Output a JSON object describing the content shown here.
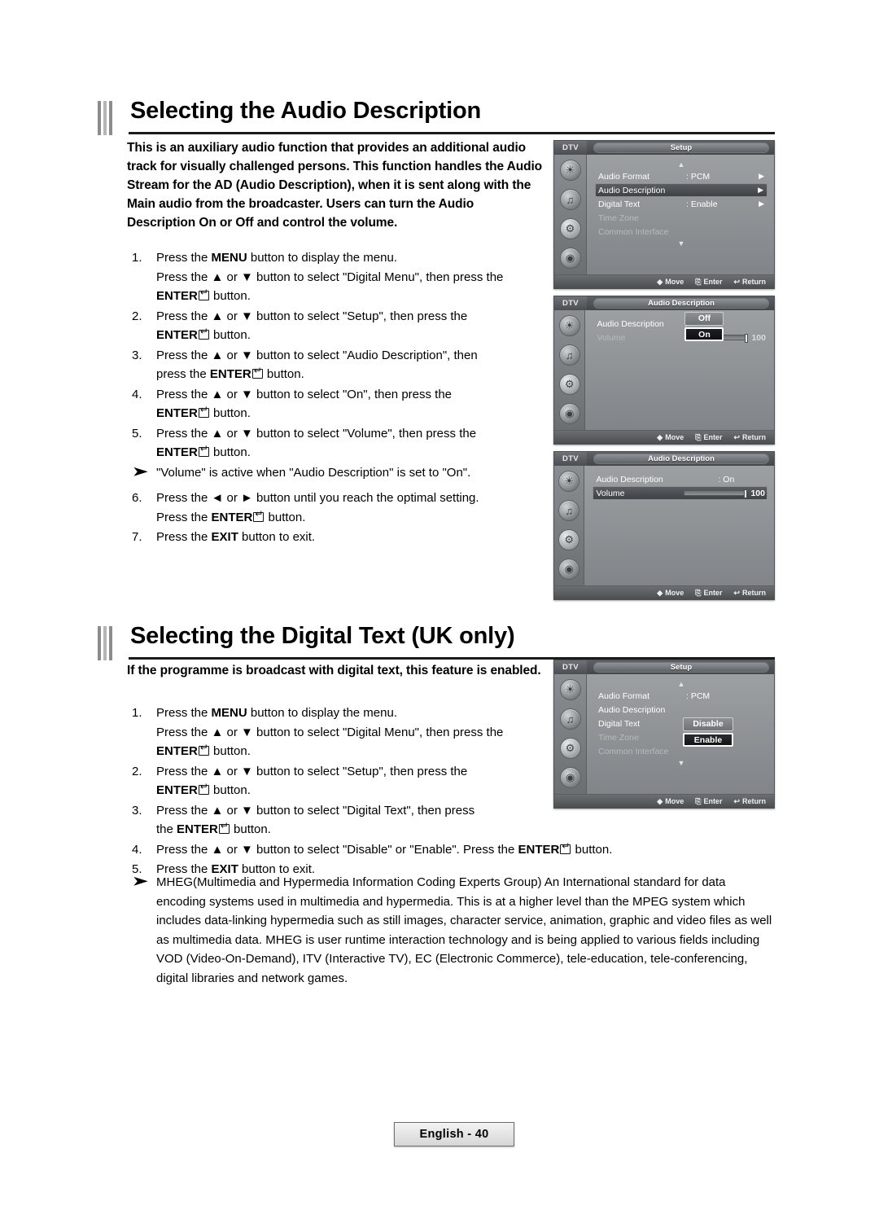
{
  "sections": [
    {
      "title": "Selecting the Audio Description",
      "intro": "This is an auxiliary audio function that provides an additional audio track for visually challenged persons. This function handles the Audio Stream for the AD (Audio Description), when it is sent along with the Main audio from the broadcaster. Users can turn the Audio Description On or Off and control the volume."
    },
    {
      "title": "Selecting the Digital Text (UK only)",
      "intro": "If the programme is broadcast with digital text, this feature is enabled."
    }
  ],
  "steps_audio": [
    {
      "num": "1.",
      "lines": [
        "Press the MENU button to display the menu.",
        "Press the ▲ or ▼ button to select \"Digital Menu\", then press the",
        "ENTER⏎ button."
      ]
    },
    {
      "num": "2.",
      "lines": [
        "Press the ▲ or ▼ button to select \"Setup\", then press the",
        "ENTER⏎ button."
      ]
    },
    {
      "num": "3.",
      "lines": [
        "Press the ▲ or ▼ button to select \"Audio Description\", then",
        "press the ENTER⏎ button."
      ]
    },
    {
      "num": "4.",
      "lines": [
        "Press the ▲ or ▼ button to select \"On\", then press the",
        "ENTER⏎ button."
      ]
    },
    {
      "num": "5.",
      "lines": [
        "Press the ▲ or ▼ button to select \"Volume\", then press the",
        "ENTER⏎ button."
      ]
    },
    {
      "num": "6.",
      "lines": [
        "Press the ◄ or ► button until you reach the optimal setting.",
        "Press the ENTER⏎ button."
      ]
    },
    {
      "num": "7.",
      "lines": [
        "Press the EXIT button to exit."
      ]
    }
  ],
  "note_audio": "\"Volume\" is active when \"Audio Description\" is set to \"On\".",
  "steps_text": [
    {
      "num": "1.",
      "lines": [
        "Press the MENU button to display the menu.",
        "Press the ▲ or ▼ button to select \"Digital Menu\", then press the",
        "ENTER⏎ button."
      ]
    },
    {
      "num": "2.",
      "lines": [
        "Press the ▲ or ▼ button to select \"Setup\", then press the",
        "ENTER⏎ button."
      ]
    },
    {
      "num": "3.",
      "lines": [
        "Press the ▲ or ▼ button to select \"Digital Text\", then press",
        "the ENTER⏎ button."
      ]
    },
    {
      "num": "4.",
      "lines": [
        "Press the ▲ or ▼ button to select \"Disable\" or \"Enable\". Press the ENTER⏎ button."
      ]
    },
    {
      "num": "5.",
      "lines": [
        "Press the EXIT button to exit."
      ]
    }
  ],
  "mheg_note": "MHEG(Multimedia and Hypermedia Information Coding Experts Group) An International standard for data encoding systems used in multimedia and hypermedia. This is at a higher level than the MPEG system which includes data-linking hypermedia such as still images, character service, animation, graphic and video files as well as multimedia data. MHEG is user runtime interaction technology and is being applied to various fields including VOD (Video-On-Demand), ITV (Interactive TV), EC (Electronic Commerce), tele-education, tele-conferencing, digital libraries and network games.",
  "osd": {
    "dtv_label": "DTV",
    "footer": {
      "move": "Move",
      "enter": "Enter",
      "return": "Return"
    },
    "panel1": {
      "title": "Setup",
      "rows": [
        {
          "label": "Audio Format",
          "value": ": PCM",
          "chevron": "▶",
          "state": "normal"
        },
        {
          "label": "Audio Description",
          "value": "",
          "chevron": "▶",
          "state": "highlight"
        },
        {
          "label": "Digital Text",
          "value": ": Enable",
          "chevron": "▶",
          "state": "normal"
        },
        {
          "label": "Time Zone",
          "value": "",
          "chevron": "",
          "state": "dim"
        },
        {
          "label": "Common Interface",
          "value": "",
          "chevron": "",
          "state": "dim"
        }
      ],
      "up": "▲",
      "down": "▼"
    },
    "panel2": {
      "title": "Audio Description",
      "rows": [
        {
          "label": "Audio Description",
          "value": ":",
          "state": "normal"
        },
        {
          "label": "Volume",
          "value": "",
          "state": "dim"
        }
      ],
      "options": {
        "off": "Off",
        "on": "On"
      },
      "volume_value": "100"
    },
    "panel3": {
      "title": "Audio Description",
      "rows": [
        {
          "label": "Audio Description",
          "value": ": On",
          "state": "normal"
        },
        {
          "label": "Volume",
          "value": "",
          "state": "highlight"
        }
      ],
      "volume_value": "100"
    },
    "panel4": {
      "title": "Setup",
      "rows": [
        {
          "label": "Audio Format",
          "value": ": PCM",
          "state": "normal"
        },
        {
          "label": "Audio Description",
          "value": "",
          "state": "normal"
        },
        {
          "label": "Digital Text",
          "value": "",
          "state": "normal"
        },
        {
          "label": "Time Zone",
          "value": "",
          "state": "dim"
        },
        {
          "label": "Common Interface",
          "value": "",
          "state": "dim"
        }
      ],
      "options": {
        "disable": "Disable",
        "enable": "Enable"
      },
      "up": "▲",
      "down": "▼"
    }
  },
  "footer": {
    "page": "English - 40"
  }
}
